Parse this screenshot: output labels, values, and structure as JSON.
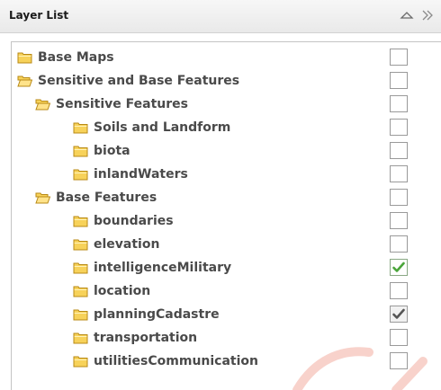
{
  "panel": {
    "title": "Layer List"
  },
  "header_buttons": {
    "collapse_icon": "collapse-up-icon",
    "expand_icon": "expand-right-icon"
  },
  "layers": [
    {
      "label": "Base Maps",
      "level": 0,
      "folder": "closed",
      "checked": false
    },
    {
      "label": "Sensitive and Base Features",
      "level": 0,
      "folder": "open",
      "checked": false
    },
    {
      "label": "Sensitive Features",
      "level": 1,
      "folder": "open",
      "checked": false
    },
    {
      "label": "Soils and Landform",
      "level": 2,
      "folder": "closed",
      "checked": false
    },
    {
      "label": "biota",
      "level": 2,
      "folder": "closed",
      "checked": false
    },
    {
      "label": "inlandWaters",
      "level": 2,
      "folder": "closed",
      "checked": false
    },
    {
      "label": "Base Features",
      "level": 1,
      "folder": "open",
      "checked": false
    },
    {
      "label": "boundaries",
      "level": 2,
      "folder": "closed",
      "checked": false
    },
    {
      "label": "elevation",
      "level": 2,
      "folder": "closed",
      "checked": false
    },
    {
      "label": "intelligenceMilitary",
      "level": 2,
      "folder": "closed",
      "checked": true,
      "check_color": "#4aa53a"
    },
    {
      "label": "location",
      "level": 2,
      "folder": "closed",
      "checked": false
    },
    {
      "label": "planningCadastre",
      "level": 2,
      "folder": "closed",
      "checked": true,
      "check_color": "#555555"
    },
    {
      "label": "transportation",
      "level": 2,
      "folder": "closed",
      "checked": false
    },
    {
      "label": "utilitiesCommunication",
      "level": 2,
      "folder": "closed",
      "checked": false
    }
  ],
  "colors": {
    "folder_fill": "#f7d25a",
    "folder_stroke": "#b88a16",
    "label_text": "#4a4a4a",
    "header_bg": "#eeeeee"
  }
}
